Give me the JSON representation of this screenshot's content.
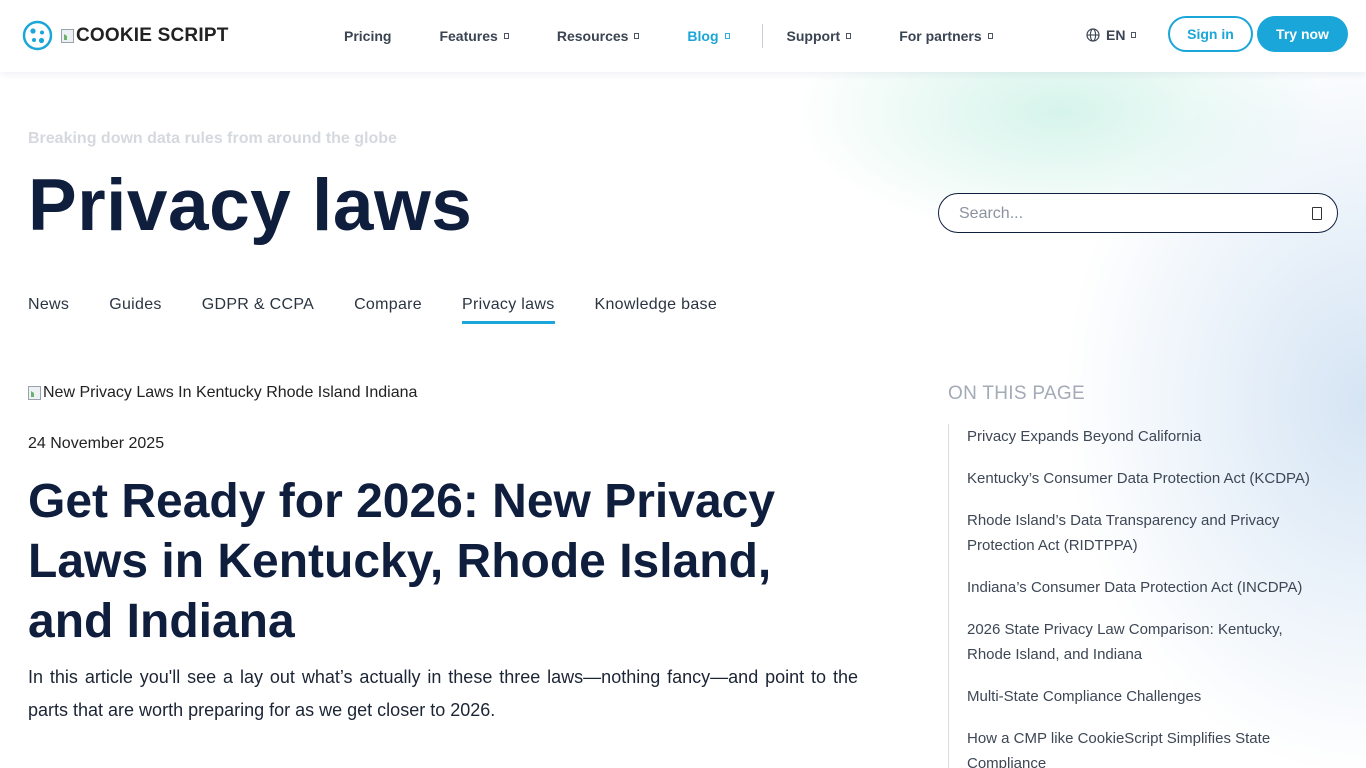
{
  "header": {
    "logo_text": "COOKIE SCRIPT",
    "nav": [
      {
        "label": "Pricing",
        "has_dropdown": false,
        "active": false
      },
      {
        "label": "Features",
        "has_dropdown": true,
        "active": false
      },
      {
        "label": "Resources",
        "has_dropdown": true,
        "active": false
      },
      {
        "label": "Blog",
        "has_dropdown": true,
        "active": true
      },
      {
        "label": "Support",
        "has_dropdown": true,
        "active": false
      },
      {
        "label": "For partners",
        "has_dropdown": true,
        "active": false
      }
    ],
    "language": "EN",
    "signin_label": "Sign in",
    "try_label": "Try now"
  },
  "hero": {
    "eyebrow": "Breaking down data rules from around the globe",
    "title": "Privacy laws"
  },
  "search": {
    "placeholder": "Search..."
  },
  "tabs": [
    {
      "label": "News",
      "active": false
    },
    {
      "label": "Guides",
      "active": false
    },
    {
      "label": "GDPR & CCPA",
      "active": false
    },
    {
      "label": "Compare",
      "active": false
    },
    {
      "label": "Privacy laws",
      "active": true
    },
    {
      "label": "Knowledge base",
      "active": false
    }
  ],
  "article": {
    "image_alt": "New Privacy Laws In Kentucky Rhode Island Indiana",
    "date": "24 November 2025",
    "title": "Get Ready for 2026: New Privacy Laws in Kentucky, Rhode Island, and Indiana",
    "intro": "In this article you'll see a lay out what’s actually in these three laws—nothing fancy—and point to the parts that are worth preparing for as we get closer to 2026."
  },
  "toc": {
    "heading": "ON THIS PAGE",
    "items": [
      "Privacy Expands Beyond California",
      "Kentucky’s Consumer Data Protection Act (KCDPA)",
      "Rhode Island’s Data Transparency and Privacy Protection Act (RIDTPPA)",
      "Indiana’s Consumer Data Protection Act (INCDPA)",
      "2026 State Privacy Law Comparison: Kentucky, Rhode Island, and Indiana",
      "Multi-State Compliance Challenges",
      "How a CMP like CookieScript Simplifies State Compliance"
    ]
  },
  "colors": {
    "accent": "#1aa6d8",
    "heading": "#0f1e3d",
    "muted": "#a2abb6"
  }
}
